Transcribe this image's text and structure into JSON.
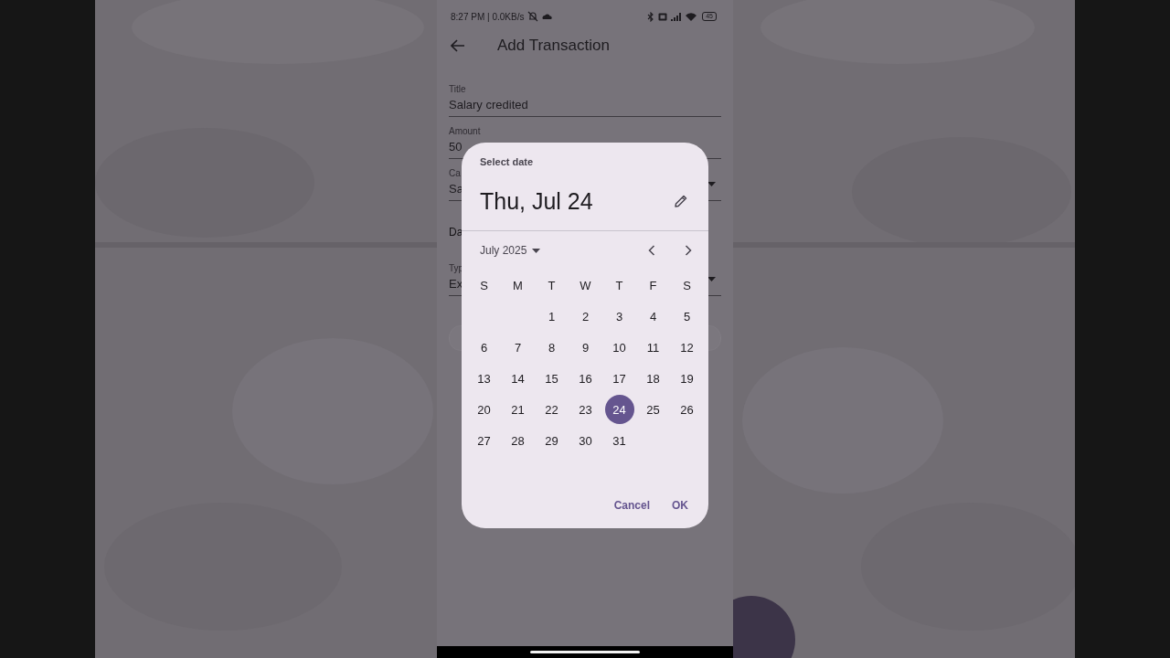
{
  "status_bar": {
    "time_speed": "8:27 PM | 0.0KB/s",
    "battery": "45"
  },
  "app_bar": {
    "title": "Add Transaction"
  },
  "form": {
    "fields": [
      {
        "kind": "text",
        "label": "Title",
        "value": "Salary credited"
      },
      {
        "kind": "text",
        "label": "Amount",
        "value": "50"
      },
      {
        "kind": "dropdown",
        "label": "Ca",
        "value": "Sa"
      },
      {
        "kind": "date",
        "value": "Da"
      },
      {
        "kind": "dropdown",
        "label": "Typ",
        "value": "Ex"
      }
    ]
  },
  "date_picker": {
    "title": "Select date",
    "headline": "Thu, Jul 24",
    "month": "July 2025",
    "weekdays": [
      "S",
      "M",
      "T",
      "W",
      "T",
      "F",
      "S"
    ],
    "weeks": [
      [
        {
          "kind": "blank"
        },
        {
          "kind": "blank"
        },
        {
          "kind": "day",
          "day": "1",
          "selected": false
        },
        {
          "day": "2",
          "selected": false
        },
        {
          "day": "3",
          "selected": false
        },
        {
          "day": "4",
          "selected": false
        },
        {
          "day": "5",
          "selected": false
        }
      ],
      [
        {
          "day": "6",
          "selected": false
        },
        {
          "day": "7",
          "selected": false
        },
        {
          "day": "8",
          "selected": false
        },
        {
          "day": "9",
          "selected": false
        },
        {
          "day": "10",
          "selected": false
        },
        {
          "day": "11",
          "selected": false
        },
        {
          "day": "12",
          "selected": false
        }
      ],
      [
        {
          "day": "13",
          "selected": false
        },
        {
          "day": "14",
          "selected": false
        },
        {
          "day": "15",
          "selected": false
        },
        {
          "day": "16",
          "selected": false
        },
        {
          "day": "17",
          "selected": false
        },
        {
          "day": "18",
          "selected": false
        },
        {
          "day": "19",
          "selected": false
        }
      ],
      [
        {
          "day": "20",
          "selected": false
        },
        {
          "day": "21",
          "selected": false
        },
        {
          "day": "22",
          "selected": false
        },
        {
          "day": "23",
          "selected": false
        },
        {
          "day": "24",
          "selected": true
        },
        {
          "day": "25",
          "selected": false
        },
        {
          "day": "26",
          "selected": false
        }
      ],
      [
        {
          "day": "27",
          "selected": false
        },
        {
          "day": "28",
          "selected": false
        },
        {
          "day": "29",
          "selected": false
        },
        {
          "day": "30",
          "selected": false
        },
        {
          "day": "31",
          "selected": false
        }
      ]
    ],
    "actions": [
      "Cancel",
      "OK"
    ]
  }
}
